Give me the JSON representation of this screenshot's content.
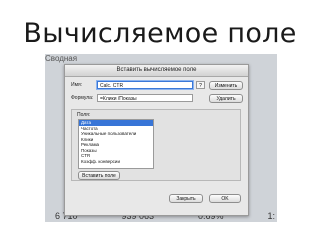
{
  "slide": {
    "title": "Вычисляемое поле"
  },
  "background": {
    "top_text": "Сводная",
    "bottom_values": [
      "6 710",
      "939 063",
      "0.69%",
      "1:"
    ]
  },
  "dialog": {
    "title": "Вставить вычисляемое поле",
    "name_label": "Имя:",
    "name_value": "Calc. CTR",
    "help_label": "?",
    "change_button": "Изменить",
    "formula_label": "Формула:",
    "formula_value": "=Клики /Показы",
    "delete_button": "Удалить",
    "fields_label": "Поля:",
    "fields": [
      "Дата",
      "Частота",
      "Уникальные пользователи",
      "Клики",
      "Реклама",
      "Показы",
      "CTR",
      "Коэфф. конверсии"
    ],
    "selected_field_index": 0,
    "insert_field_button": "Вставить поле",
    "close_button": "Закрыть",
    "ok_button": "OK"
  }
}
